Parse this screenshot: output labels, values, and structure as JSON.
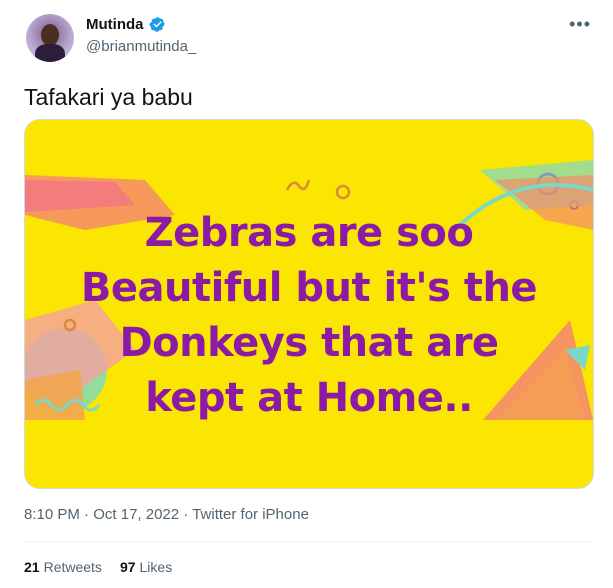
{
  "author": {
    "name": "Mutinda",
    "handle": "@brianmutinda_"
  },
  "tweet": {
    "text": "Tafakari ya babu",
    "image_text": [
      "Zebras are soo",
      "Beautiful but it's the",
      "Donkeys that are",
      "kept at Home.."
    ]
  },
  "meta": {
    "time": "8:10 PM",
    "separator": "·",
    "date": "Oct 17, 2022",
    "source": "Twitter for iPhone"
  },
  "stats": {
    "retweets_count": "21",
    "retweets_label": "Retweets",
    "likes_count": "97",
    "likes_label": "Likes"
  },
  "colors": {
    "image_background": "#fae600",
    "image_text": "#8b1aa6",
    "verified": "#1d9bf0"
  },
  "icons": {
    "more": "more-icon",
    "verified": "verified-badge-icon"
  }
}
